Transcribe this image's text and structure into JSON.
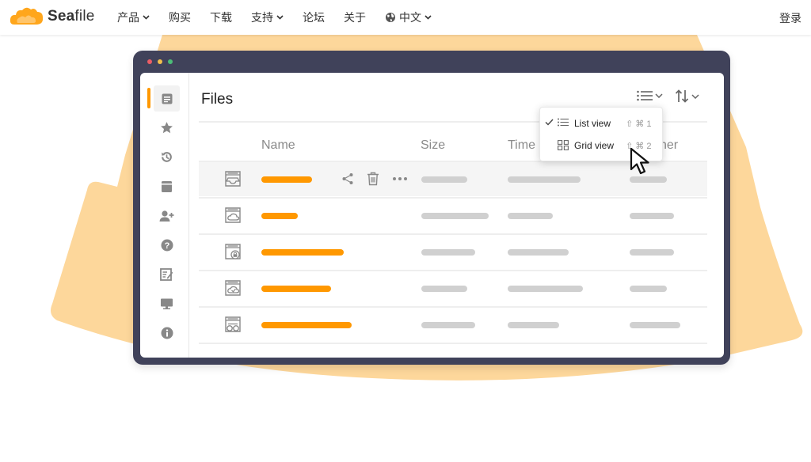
{
  "header": {
    "logo_text_bold": "Sea",
    "logo_text_rest": "file",
    "nav": [
      {
        "label": "产品",
        "has_dropdown": true
      },
      {
        "label": "购买",
        "has_dropdown": false
      },
      {
        "label": "下载",
        "has_dropdown": false
      },
      {
        "label": "支持",
        "has_dropdown": true
      },
      {
        "label": "论坛",
        "has_dropdown": false
      },
      {
        "label": "关于",
        "has_dropdown": false
      },
      {
        "label": "中文",
        "has_dropdown": true,
        "icon": "globe-icon"
      }
    ],
    "login_label": "登录"
  },
  "colors": {
    "accent": "#ff9800",
    "blob": "#fdd79b",
    "window_frame": "#40425a",
    "dot_red": "#ec5d65",
    "dot_yellow": "#f3bf4b",
    "dot_green": "#4cbd78"
  },
  "app": {
    "title": "Files",
    "sidebar_icons": [
      "files-icon",
      "star-icon",
      "history-icon",
      "library-icon",
      "add-user-icon",
      "help-icon",
      "notes-icon",
      "monitor-icon",
      "info-icon"
    ],
    "columns": {
      "name": "Name",
      "size": "Size",
      "time": "Time",
      "owner": "ner"
    },
    "rows": [
      {
        "icon": "library-tray-icon",
        "hover": true
      },
      {
        "icon": "library-cloud-icon",
        "hover": false
      },
      {
        "icon": "library-lock-icon",
        "hover": false
      },
      {
        "icon": "library-check-icon",
        "hover": false
      },
      {
        "icon": "library-glasses-icon",
        "hover": false
      }
    ],
    "row_actions": [
      "share-icon",
      "trash-icon",
      "more-icon"
    ],
    "view_menu": {
      "items": [
        {
          "label": "List view",
          "shortcut": "⇧ ⌘ 1",
          "checked": true,
          "icon": "list-icon"
        },
        {
          "label": "Grid view",
          "shortcut": "⇧ ⌘ 2",
          "checked": false,
          "icon": "grid-icon"
        }
      ]
    }
  }
}
